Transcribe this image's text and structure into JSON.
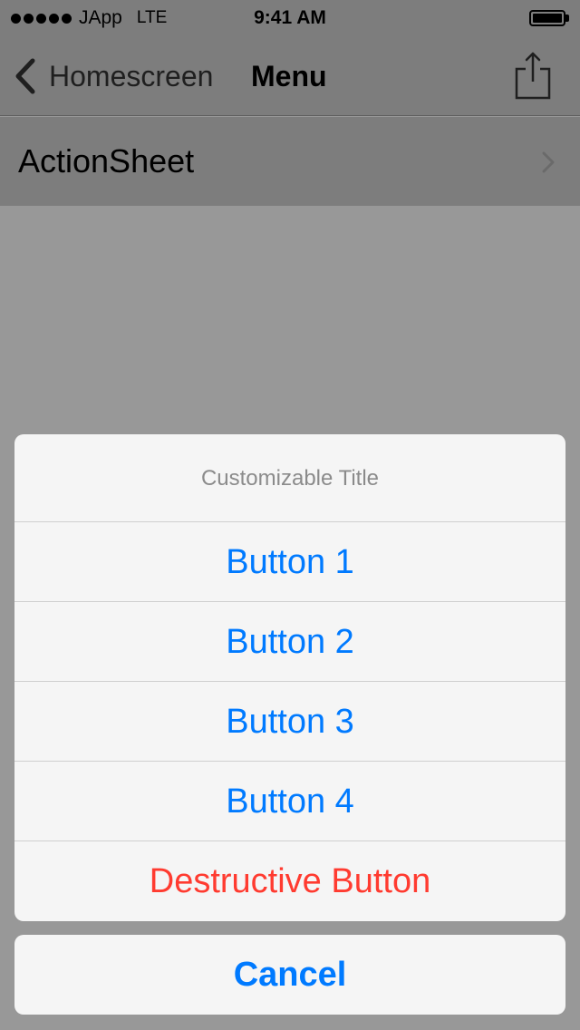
{
  "status_bar": {
    "carrier": "JApp",
    "network": "LTE",
    "time": "9:41 AM",
    "signal_icon": "signal-dots-icon",
    "battery_icon": "battery-icon"
  },
  "nav_bar": {
    "back_label": "Homescreen",
    "title": "Menu",
    "back_icon": "chevron-left-icon",
    "share_icon": "share-icon"
  },
  "table": {
    "rows": [
      {
        "label": "ActionSheet",
        "accessory_icon": "chevron-right-icon"
      }
    ]
  },
  "action_sheet": {
    "title": "Customizable Title",
    "buttons": [
      {
        "label": "Button 1"
      },
      {
        "label": "Button 2"
      },
      {
        "label": "Button 3"
      },
      {
        "label": "Button 4"
      }
    ],
    "destructive_label": "Destructive Button",
    "cancel_label": "Cancel"
  },
  "colors": {
    "tint": "#007aff",
    "destructive": "#ff3b30",
    "dimmed_background": "#989898"
  }
}
